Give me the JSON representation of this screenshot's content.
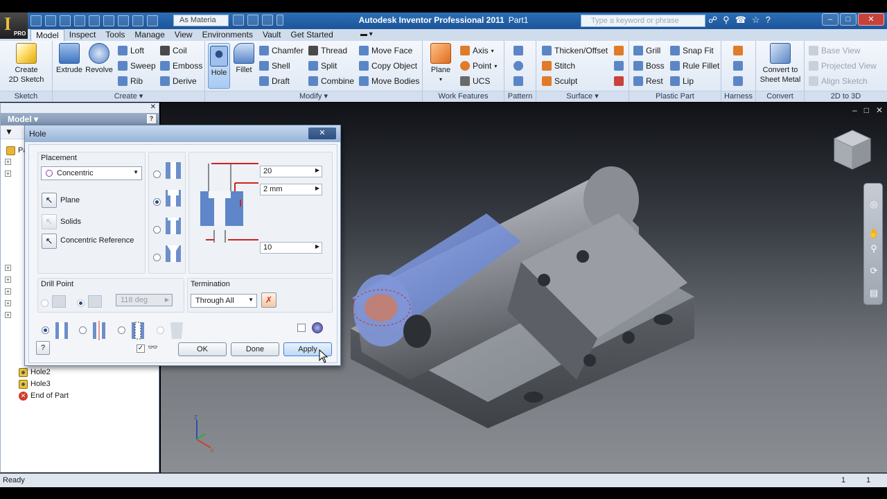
{
  "window": {
    "app_title": "Autodesk Inventor Professional 2011",
    "doc_name": "Part1",
    "logo_label": "PRO",
    "material": "As Materia",
    "help_search_placeholder": "Type a keyword or phrase",
    "accent": "#2b6fb6"
  },
  "ribbon_tabs": [
    "Model",
    "Inspect",
    "Tools",
    "Manage",
    "View",
    "Environments",
    "Vault",
    "Get Started"
  ],
  "active_tab": "Model",
  "ribbon": {
    "sketch": {
      "title": "Sketch",
      "create_2d_sketch_l1": "Create",
      "create_2d_sketch_l2": "2D Sketch"
    },
    "create": {
      "title": "Create",
      "extrude": "Extrude",
      "revolve": "Revolve",
      "loft": "Loft",
      "sweep": "Sweep",
      "rib": "Rib",
      "coil": "Coil",
      "emboss": "Emboss",
      "derive": "Derive"
    },
    "modify": {
      "title": "Modify",
      "hole": "Hole",
      "fillet": "Fillet",
      "chamfer": "Chamfer",
      "shell": "Shell",
      "draft": "Draft",
      "thread": "Thread",
      "split": "Split",
      "combine": "Combine",
      "move_face": "Move Face",
      "copy_object": "Copy Object",
      "move_bodies": "Move Bodies"
    },
    "work_features": {
      "title": "Work Features",
      "plane": "Plane",
      "axis": "Axis",
      "point": "Point",
      "ucs": "UCS"
    },
    "pattern": {
      "title": "Pattern"
    },
    "surface": {
      "title": "Surface",
      "thicken_offset": "Thicken/Offset",
      "stitch": "Stitch",
      "sculpt": "Sculpt"
    },
    "plastic_part": {
      "title": "Plastic Part",
      "grill": "Grill",
      "boss": "Boss",
      "rest": "Rest",
      "snap_fit": "Snap Fit",
      "rule_fillet": "Rule Fillet",
      "lip": "Lip"
    },
    "harness": {
      "title": "Harness"
    },
    "convert": {
      "title": "Convert",
      "convert_l1": "Convert to",
      "convert_l2": "Sheet Metal"
    },
    "to3d": {
      "title": "2D to 3D",
      "base_view": "Base View",
      "projected_view": "Projected View",
      "align_sketch": "Align Sketch"
    }
  },
  "browser": {
    "header": "Model",
    "visible_items": [
      {
        "label": "Pa"
      },
      {
        "label": "Hole2"
      },
      {
        "label": "Hole3"
      },
      {
        "label": "End of Part"
      }
    ]
  },
  "hole_dialog": {
    "title": "Hole",
    "placement_label": "Placement",
    "placement_value": "Concentric",
    "plane_label": "Plane",
    "solids_label": "Solids",
    "concentric_ref_label": "Concentric Reference",
    "dim_top": "20",
    "dim_mid": "2 mm",
    "dim_bottom": "10",
    "drill_point_label": "Drill Point",
    "drill_angle": "118 deg",
    "termination_label": "Termination",
    "termination_value": "Through All",
    "ok": "OK",
    "done": "Done",
    "apply": "Apply"
  },
  "status": {
    "text": "Ready",
    "n1": "1",
    "n2": "1"
  },
  "colors": {
    "part_gray": "#8a8f96",
    "highlight_blue": "#6f8fe0",
    "dim_red": "#d02020"
  }
}
